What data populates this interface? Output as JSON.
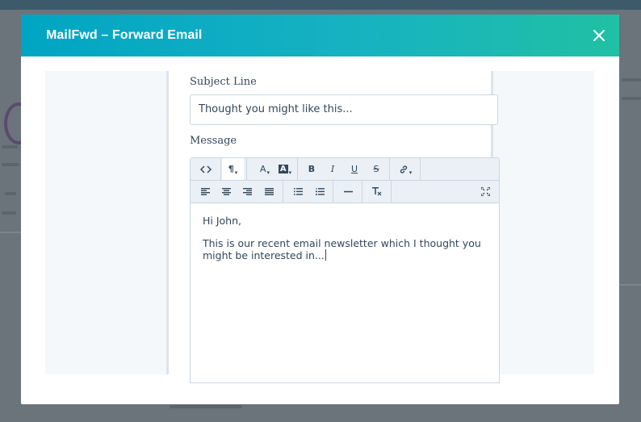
{
  "modal": {
    "title": "MailFwd – Forward Email",
    "close_icon": "close-icon"
  },
  "form": {
    "subject_label": "Subject Line",
    "subject_value": "Thought you might like this...",
    "message_label": "Message"
  },
  "toolbar": {
    "row1": [
      {
        "name": "source-code-button",
        "glyph": "<>",
        "icon": "code-icon"
      },
      {
        "name": "paragraph-style-button",
        "glyph": "¶",
        "icon": "paragraph-icon"
      },
      {
        "name": "text-color-button",
        "glyph": "A",
        "icon": "text-color-icon"
      },
      {
        "name": "highlight-color-button",
        "glyph": "A",
        "icon": "background-color-icon"
      },
      {
        "name": "bold-button",
        "glyph": "B",
        "icon": "bold-icon"
      },
      {
        "name": "italic-button",
        "glyph": "I",
        "icon": "italic-icon"
      },
      {
        "name": "underline-button",
        "glyph": "U",
        "icon": "underline-icon"
      },
      {
        "name": "strikethrough-button",
        "glyph": "S",
        "icon": "strikethrough-icon"
      },
      {
        "name": "link-button",
        "glyph": "",
        "icon": "link-icon"
      }
    ],
    "row2": [
      {
        "name": "align-left-button",
        "icon": "align-left-icon"
      },
      {
        "name": "align-center-button",
        "icon": "align-center-icon"
      },
      {
        "name": "align-right-button",
        "icon": "align-right-icon"
      },
      {
        "name": "align-justify-button",
        "icon": "align-justify-icon"
      },
      {
        "name": "bullet-list-button",
        "icon": "bullet-list-icon"
      },
      {
        "name": "numbered-list-button",
        "icon": "numbered-list-icon"
      },
      {
        "name": "horizontal-rule-button",
        "icon": "horizontal-rule-icon"
      },
      {
        "name": "clear-formatting-button",
        "icon": "clear-formatting-icon"
      },
      {
        "name": "fullscreen-button",
        "icon": "fullscreen-icon"
      }
    ]
  },
  "message": {
    "greeting": "Hi John,",
    "body": "This is our recent email newsletter which I thought you might be interested in..."
  },
  "colors": {
    "header_start": "#00a5c3",
    "header_end": "#20c0a4",
    "text": "#33475b",
    "border": "#cbd6e2",
    "toolbar_bg": "#eaf0f6"
  }
}
